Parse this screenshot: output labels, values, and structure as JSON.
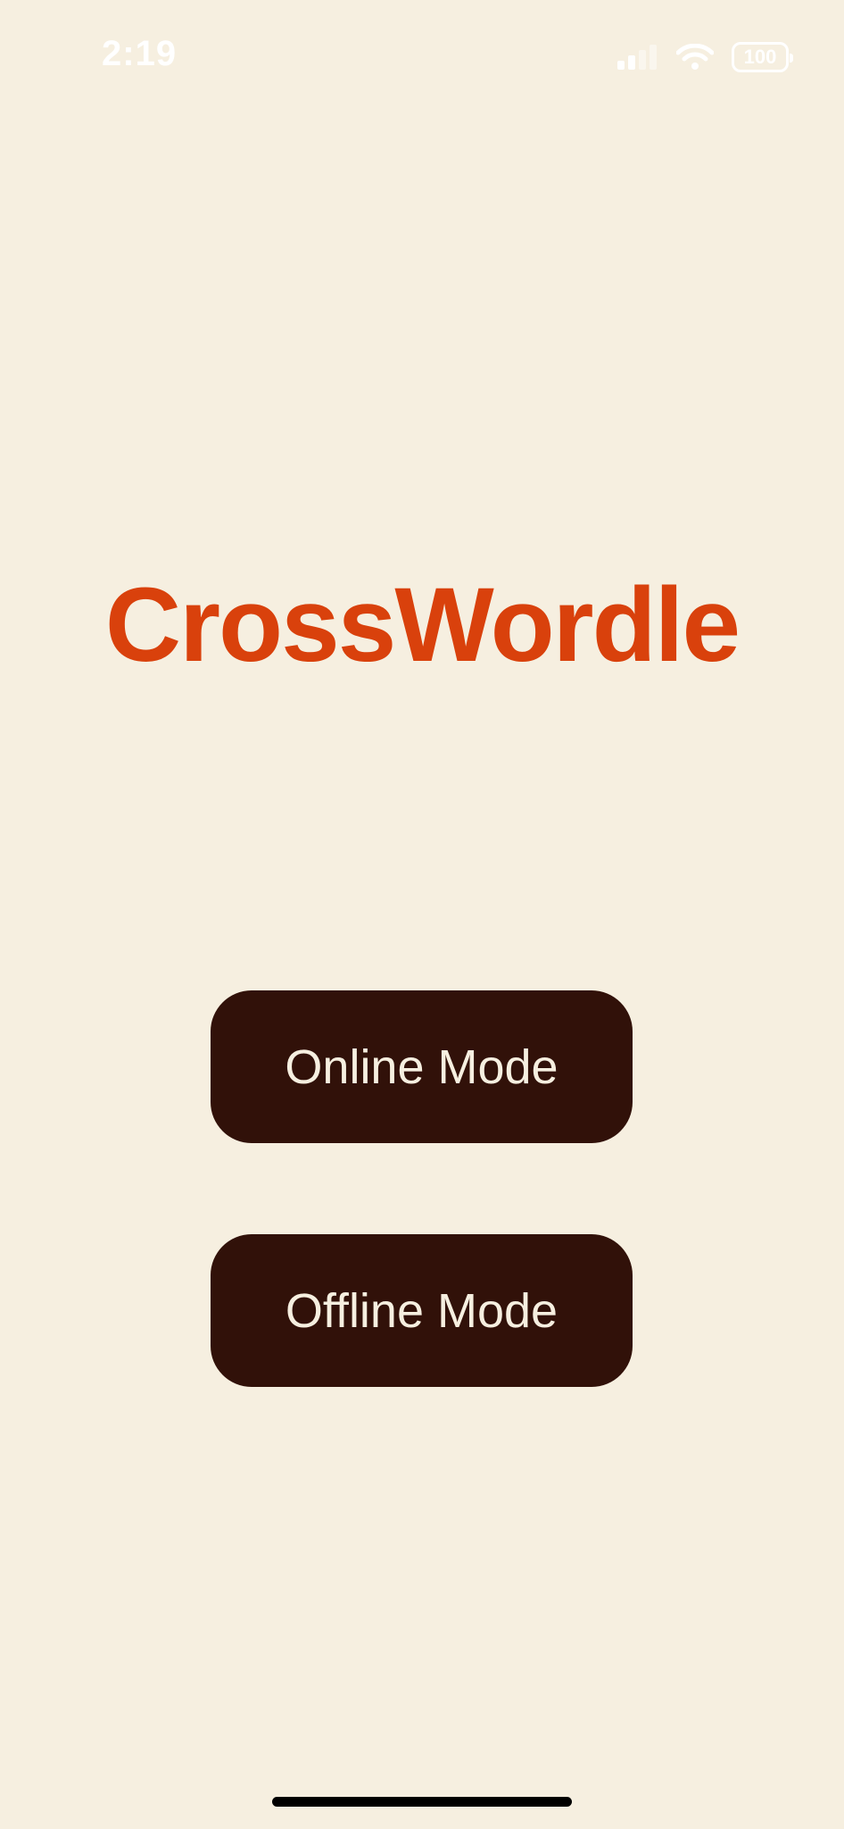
{
  "status_bar": {
    "time": "2:19",
    "battery_level": "100",
    "icons": [
      "cellular-signal-icon",
      "wifi-icon",
      "battery-icon"
    ]
  },
  "app": {
    "title": "CrossWordle"
  },
  "buttons": {
    "online_label": "Online Mode",
    "offline_label": "Offline Mode"
  },
  "colors": {
    "background": "#f6efe0",
    "title": "#d9410c",
    "button_background": "#311109",
    "button_text": "#f6efe0"
  }
}
